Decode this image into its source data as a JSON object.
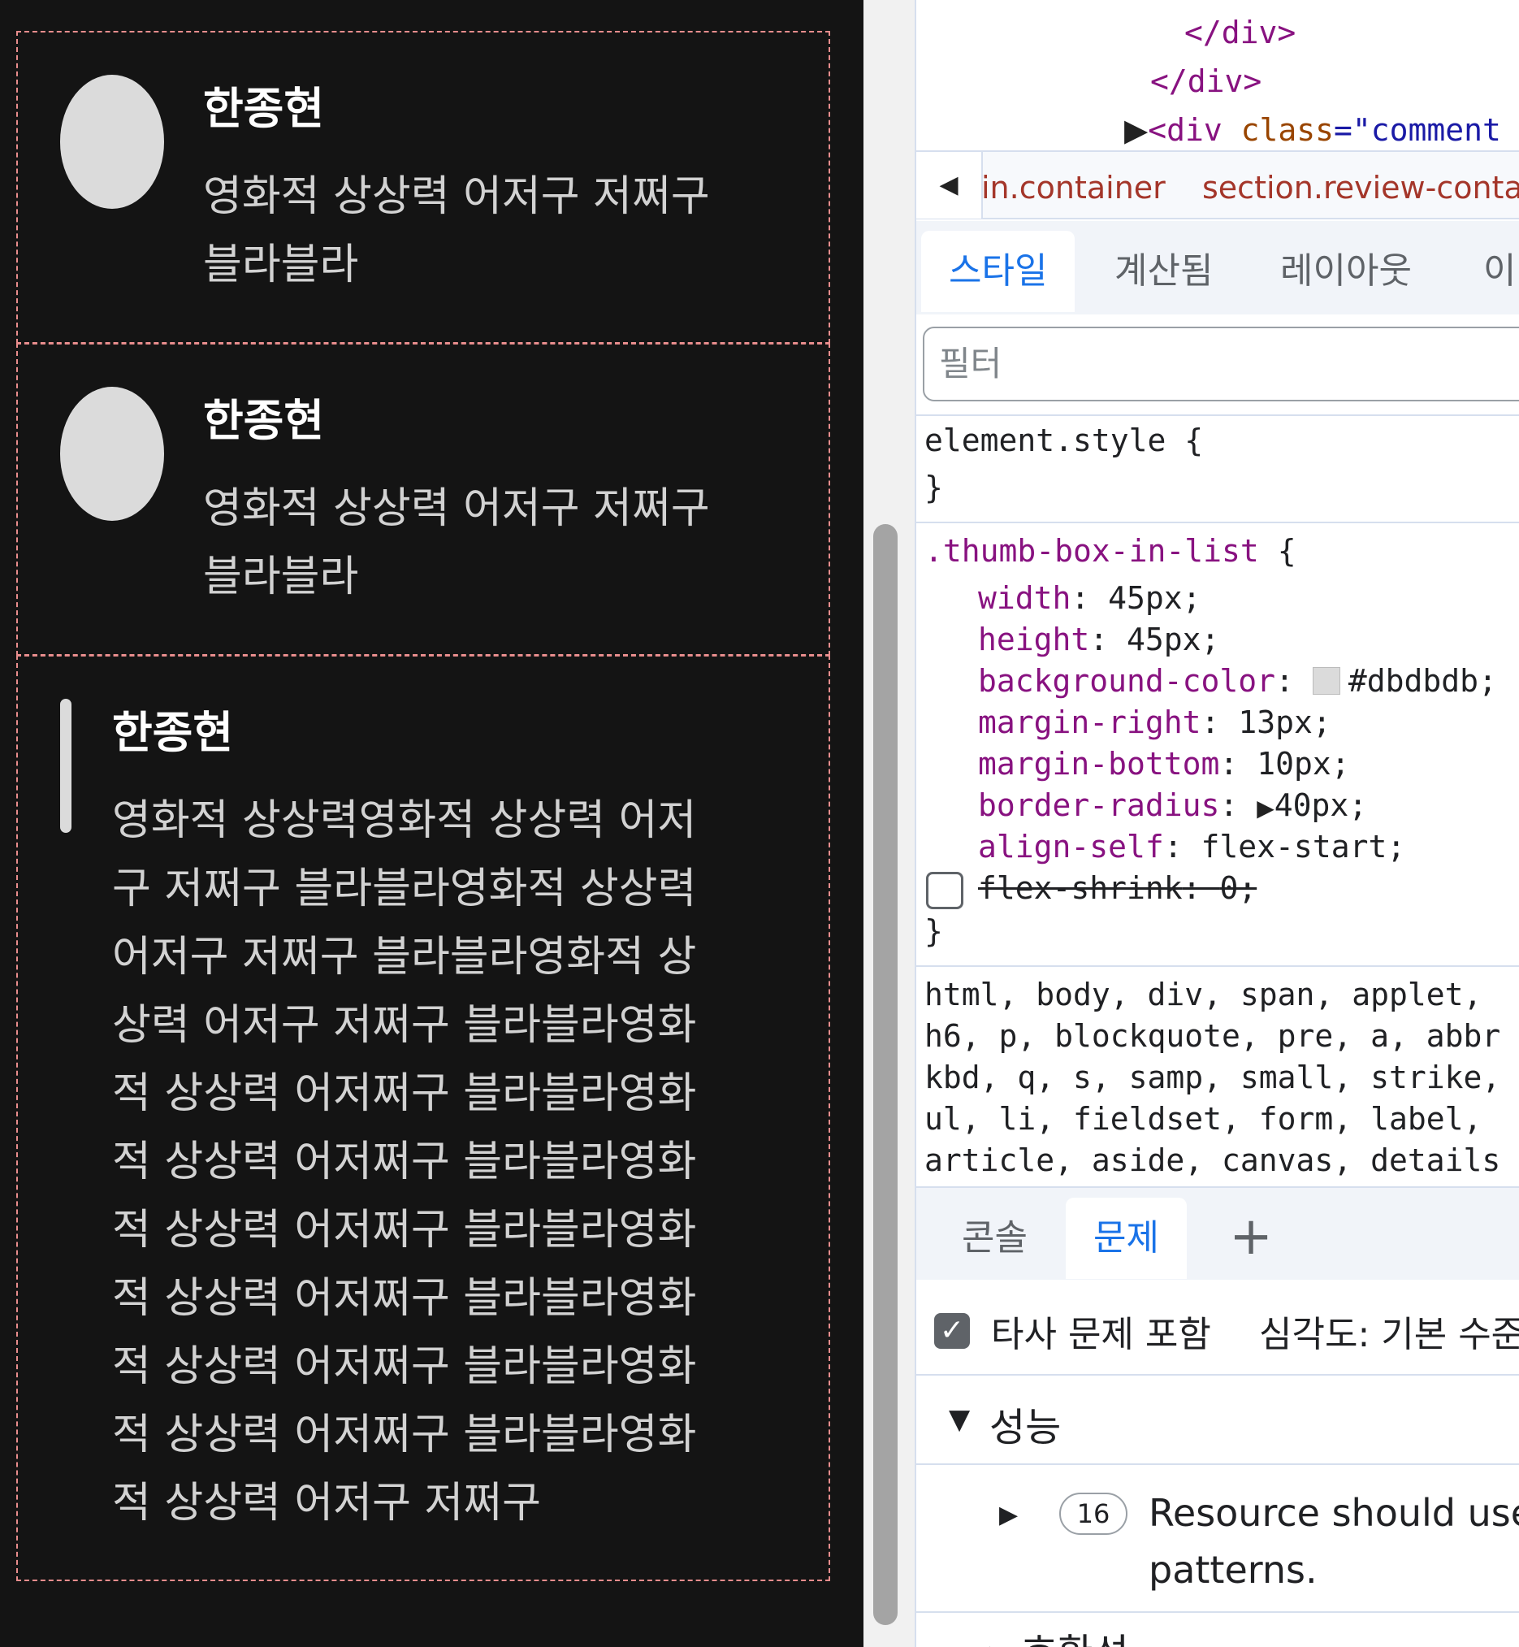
{
  "page": {
    "comments": [
      {
        "name": "한종현",
        "lines": [
          "영화적 상상력 어저구 저쩌구",
          "블라블라"
        ]
      },
      {
        "name": "한종현",
        "lines": [
          "영화적 상상력 어저구 저쩌구",
          "블라블라"
        ]
      },
      {
        "name": "한종현",
        "lines": [
          "영화적 상상력영화적 상상력 어저",
          "구 저쩌구 블라블라영화적 상상력",
          "어저구 저쩌구 블라블라영화적 상",
          "상력 어저구 저쩌구 블라블라영화",
          "적 상상력 어저쩌구 블라블라영화",
          "적 상상력 어저쩌구 블라블라영화",
          "적 상상력 어저쩌구 블라블라영화",
          "적 상상력 어저쩌구 블라블라영화",
          "적 상상력 어저쩌구 블라블라영화",
          "적 상상력 어저쩌구 블라블라영화",
          "적 상상력 어저구 저쩌구"
        ]
      }
    ]
  },
  "devtools": {
    "dom": {
      "close1": "</div>",
      "close2": "</div>",
      "open_tag": "<div",
      "open_attr": "class",
      "open_val": "=\"comment"
    },
    "breadcrumb": [
      "in.container",
      "section.review-conta"
    ],
    "tabs": [
      "스타일",
      "계산됨",
      "레이아웃",
      "이"
    ],
    "filter_placeholder": "필터",
    "element_style": {
      "selector": "element.style {",
      "close": "}"
    },
    "rule": {
      "selector": ".thumb-box-in-list",
      "brace": "{",
      "decls": [
        {
          "p": "width",
          "v": "45px;"
        },
        {
          "p": "height",
          "v": "45px;"
        },
        {
          "p": "background-color",
          "v": "#dbdbdb;"
        },
        {
          "p": "margin-right",
          "v": "13px;"
        },
        {
          "p": "margin-bottom",
          "v": "10px;"
        },
        {
          "p": "border-radius",
          "v": "40px;"
        },
        {
          "p": "align-self",
          "v": "flex-start;"
        },
        {
          "p": "flex-shrink",
          "v": "0;"
        }
      ],
      "close": "}",
      "swatch_color": "#dbdbdb"
    },
    "reset_lines": [
      "html, body, div, span, applet,",
      "h6, p, blockquote, pre, a, abbr",
      "kbd, q, s, samp, small, strike,",
      "ul, li, fieldset, form, label,",
      "article, aside, canvas, details"
    ],
    "drawer_tabs": [
      "콘솔",
      "문제"
    ],
    "add_tab": "+",
    "issues": {
      "third_party": "타사 문제 포함",
      "severity": "심각도: 기본 수준",
      "category": "성능",
      "count": "16",
      "message_1": "Resource should use",
      "message_2": "patterns.",
      "next_label": "▸ 호환성"
    }
  }
}
